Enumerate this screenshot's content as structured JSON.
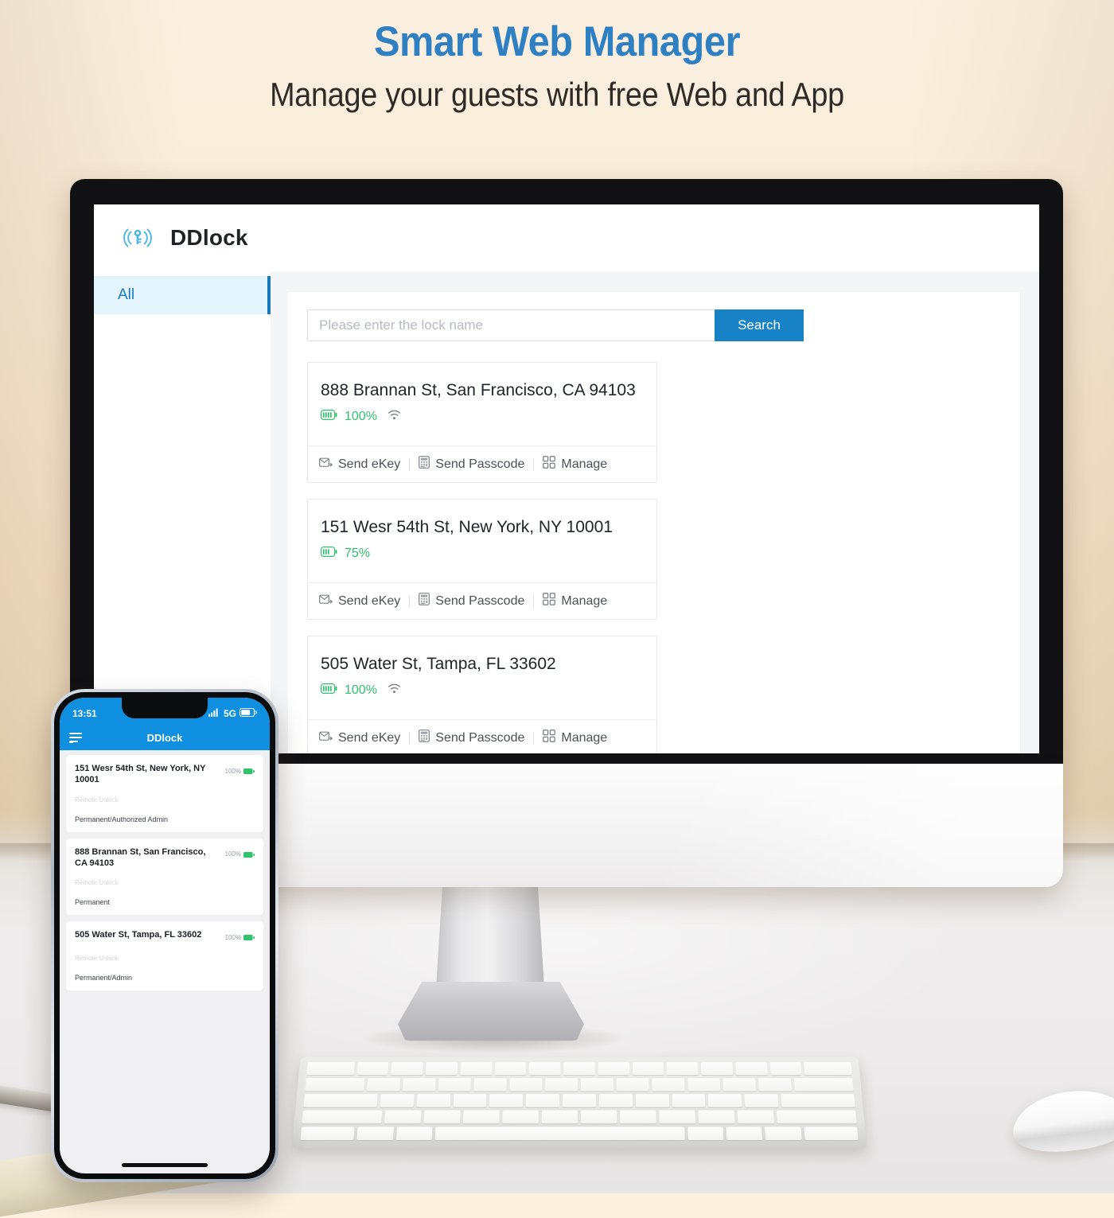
{
  "headline": {
    "title": "Smart Web Manager",
    "subtitle": "Manage your guests with free Web and App",
    "title_color": "#2f80c2",
    "subtitle_color": "#2e2b26"
  },
  "web_app": {
    "brand": "DDlock",
    "brand_icon": "key-signal-logo-icon",
    "sidebar": {
      "items": [
        {
          "label": "All",
          "active": true
        }
      ]
    },
    "search": {
      "placeholder": "Please enter the lock name",
      "value": "",
      "button_label": "Search",
      "button_color": "#1782c5"
    },
    "locks": [
      {
        "name": "888 Brannan St, San Francisco, CA 94103",
        "battery": "100%",
        "has_wifi": true,
        "actions": [
          "Send eKey",
          "Send Passcode",
          "Manage"
        ]
      },
      {
        "name": "151 Wesr 54th St, New York, NY 10001",
        "battery": "75%",
        "has_wifi": false,
        "actions": [
          "Send eKey",
          "Send Passcode",
          "Manage"
        ]
      },
      {
        "name": "505 Water St, Tampa, FL 33602",
        "battery": "100%",
        "has_wifi": true,
        "actions": [
          "Send eKey",
          "Send Passcode",
          "Manage"
        ]
      }
    ],
    "action_icons": [
      "send-ekey-icon",
      "send-passcode-icon",
      "manage-grid-icon"
    ],
    "battery_color": "#2fc46b"
  },
  "phone_app": {
    "status_bar": {
      "time": "13:51",
      "network": "5G",
      "signal_icon": "signal-bars-icon",
      "battery_icon": "battery-icon"
    },
    "nav": {
      "menu_icon": "hamburger-menu-icon",
      "title": "DDlock"
    },
    "bar_color": "#0f8fe0",
    "locks": [
      {
        "name": "151 Wesr 54th St, New York, NY 10001",
        "battery": "100%",
        "feature": "Remote Unlock",
        "role": "Permanent/Authorized Admin"
      },
      {
        "name": "888 Brannan St, San Francisco, CA 94103",
        "battery": "100%",
        "feature": "Remote Unlock",
        "role": "Permanent"
      },
      {
        "name": "505 Water St, Tampa, FL 33602",
        "battery": "100%",
        "feature": "Remote Unlock",
        "role": "Permanent/Admin"
      }
    ]
  }
}
